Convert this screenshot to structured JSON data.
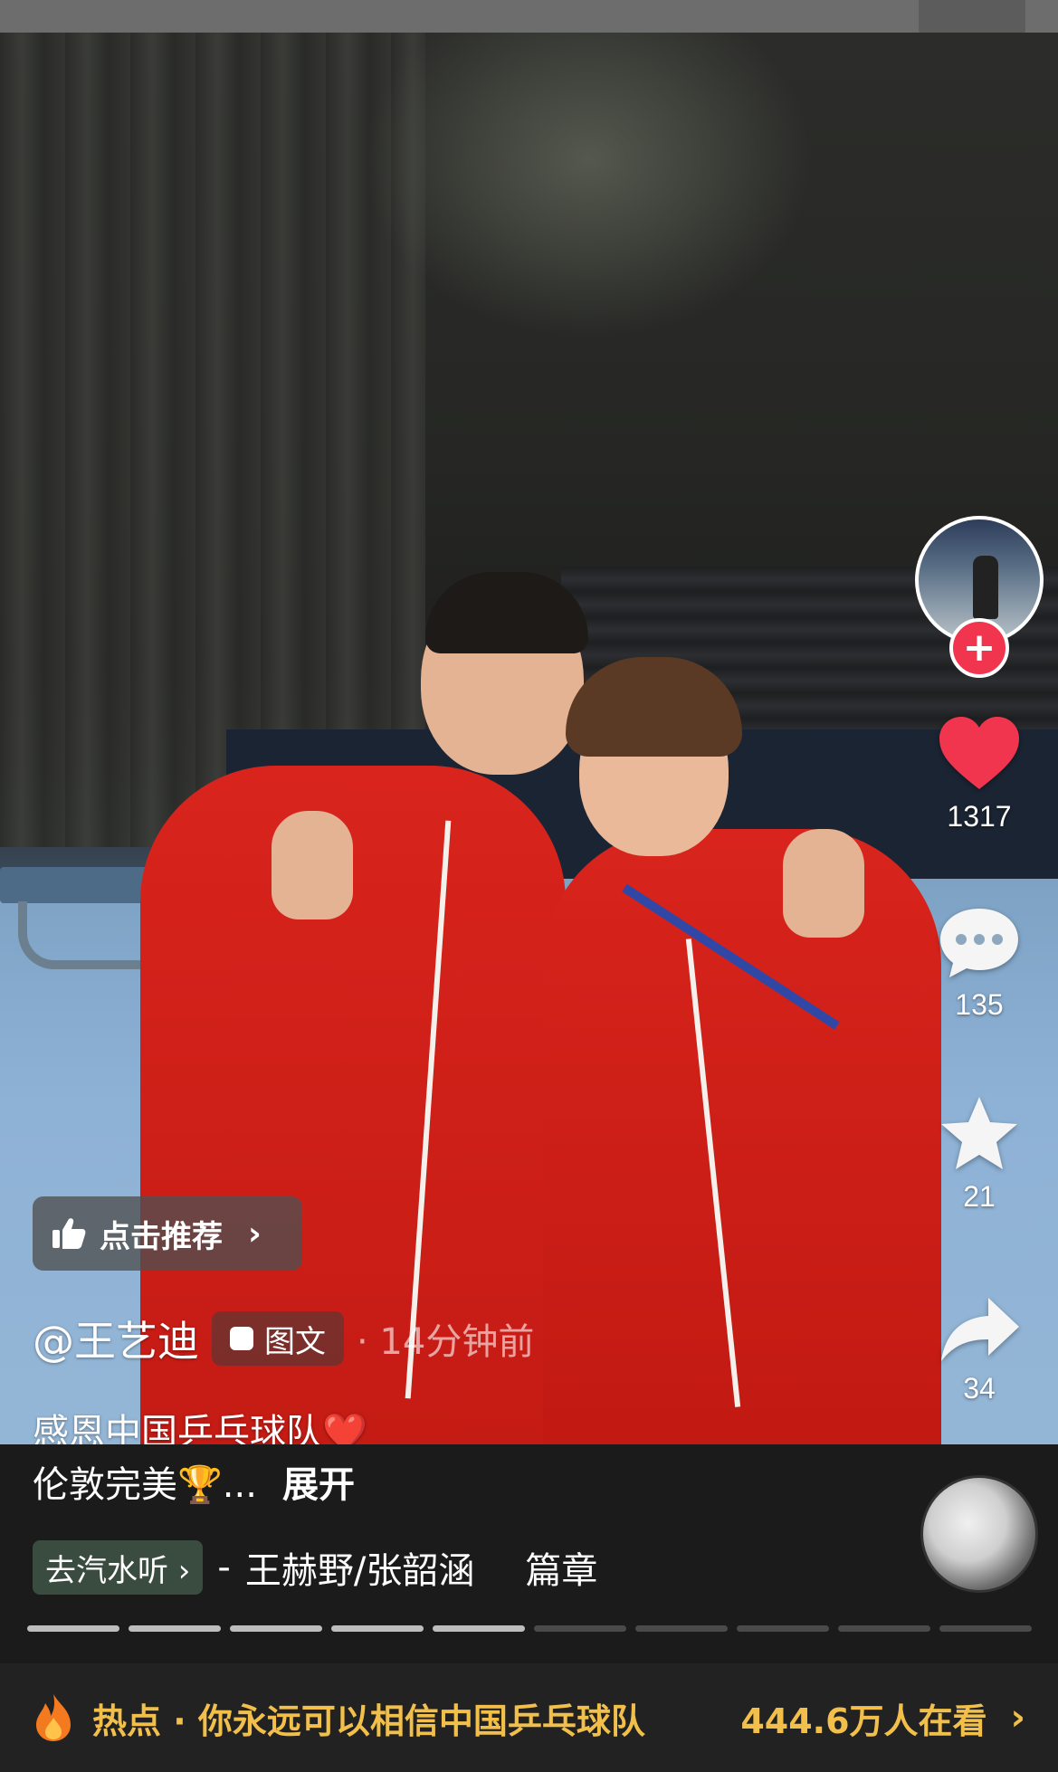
{
  "actions": {
    "like_count": "1317",
    "comment_count": "135",
    "favorite_count": "21",
    "share_count": "34"
  },
  "recommend": {
    "label": "点击推荐"
  },
  "post": {
    "author": "@王艺迪",
    "type_tag": "图文",
    "time": "· 14分钟前",
    "caption_line1": "感恩中国乒乓球队❤️",
    "caption_line2": "伦敦完美🏆...",
    "expand_label": "展开"
  },
  "music": {
    "chip_label": "去汽水听 ›",
    "separator": "-",
    "song": "王赫野/张韶涵",
    "title": "篇章"
  },
  "progress": {
    "total_segments": 10,
    "current_segment": 5
  },
  "hot": {
    "title": "热点 · 你永远可以相信中国乒乓球队",
    "viewers": "444.6万人在看"
  },
  "colors": {
    "like_red": "#f2354e",
    "hot_gold": "#f2c04a",
    "chip_green": "#3a4b3f"
  }
}
